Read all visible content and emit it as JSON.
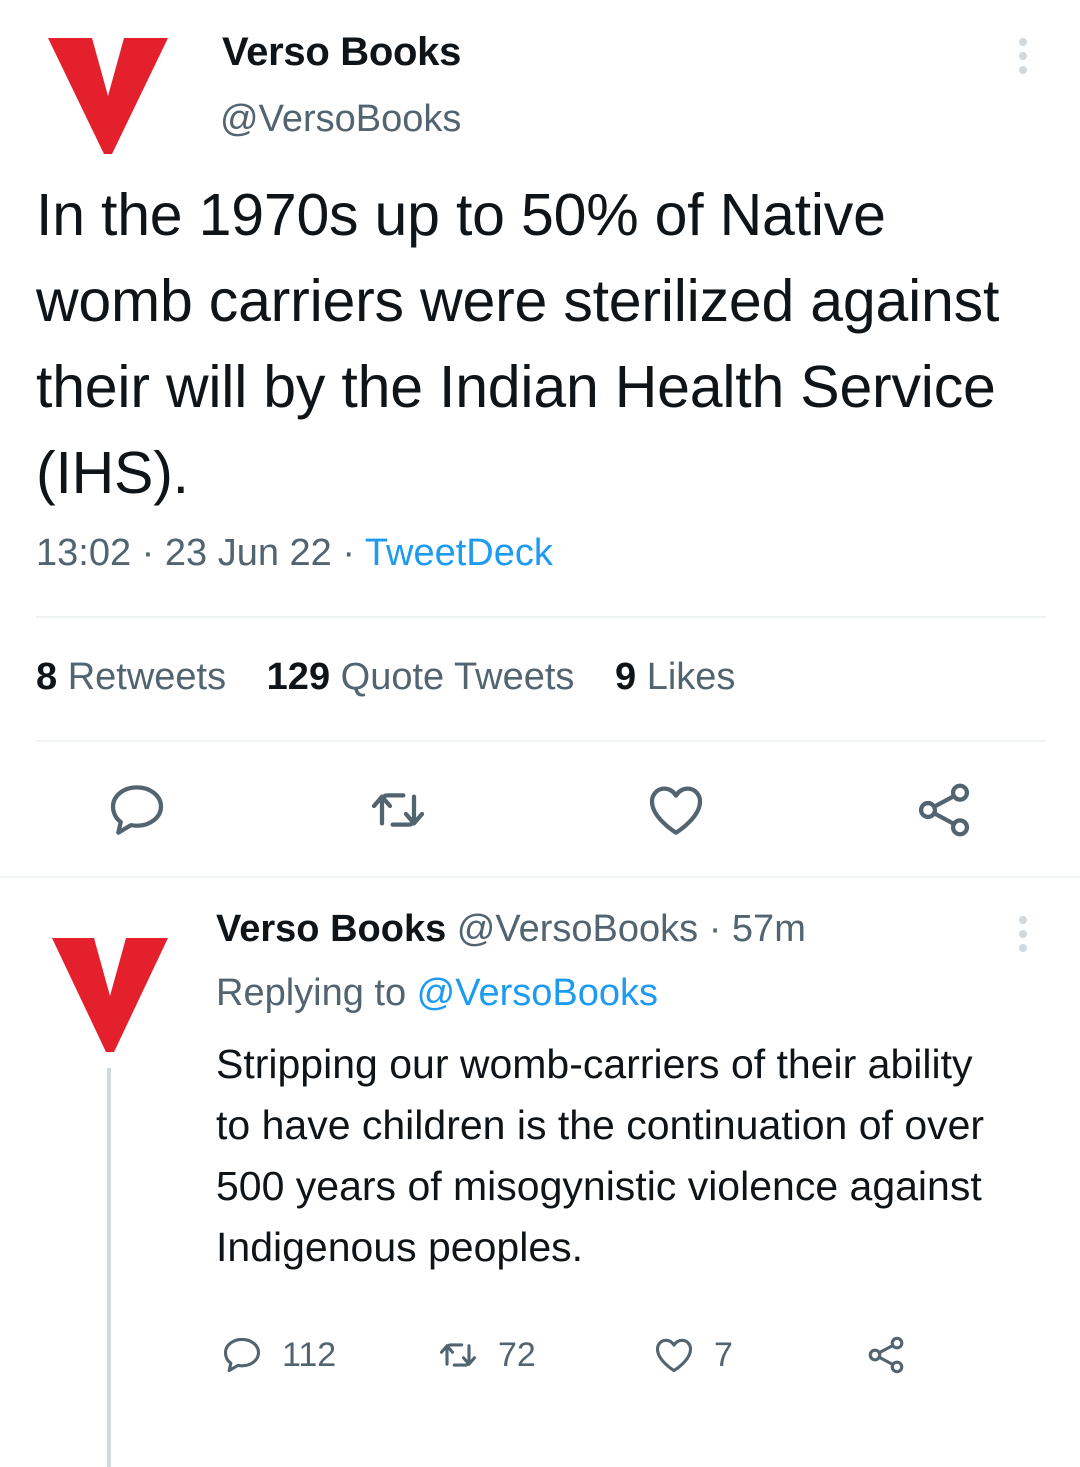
{
  "brand": {
    "logo_color": "#e4202c"
  },
  "main_tweet": {
    "display_name": "Verso Books",
    "handle": "@VersoBooks",
    "text": "In the 1970s up to 50% of Native womb carriers were sterilized against their will by the Indian Health Service (IHS).",
    "time": "13:02",
    "date": "23 Jun 22",
    "source": "TweetDeck",
    "separator": " · ",
    "stats": {
      "retweets_count": "8",
      "retweets_label": "Retweets",
      "quotes_count": "129",
      "quotes_label": "Quote Tweets",
      "likes_count": "9",
      "likes_label": "Likes"
    },
    "actions": [
      "reply-icon",
      "retweet-icon",
      "like-icon",
      "share-icon"
    ]
  },
  "reply_tweet": {
    "display_name": "Verso Books",
    "handle": "@VersoBooks",
    "time_ago": "57m",
    "separator": " · ",
    "replying_prefix": "Replying to ",
    "replying_to": "@VersoBooks",
    "text": "Stripping our womb-carriers of their ability to have children is the continuation of over 500 years of misogynistic violence against Indigenous peoples.",
    "reply_count": "112",
    "retweet_count": "72",
    "like_count": "7"
  }
}
